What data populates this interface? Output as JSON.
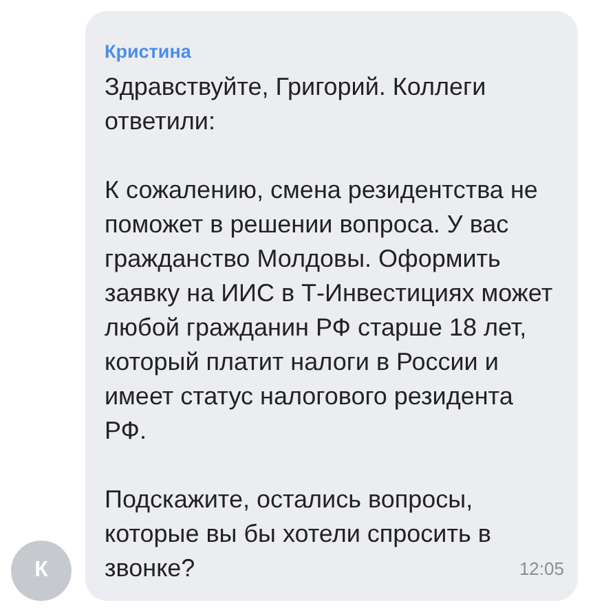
{
  "message": {
    "sender": "Кристина",
    "paragraphs": [
      "Здравствуйте, Григорий. Коллеги ответили:",
      "К сожалению, смена резидентства не поможет в решении вопроса. У вас гражданство Молдовы. Оформить заявку на ИИС в Т-Инвестициях может любой гражданин РФ старше 18 лет, который платит налоги в России и имеет статус налогового резидента РФ.",
      "Подскажите, остались вопросы, которые вы бы хотели спросить в звонке?"
    ],
    "time": "12:05",
    "avatar_letter": "К"
  }
}
